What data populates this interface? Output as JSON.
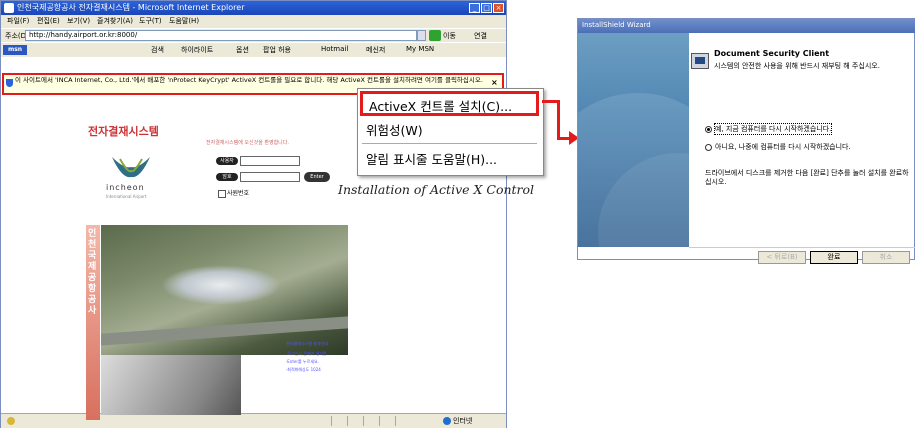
{
  "ie": {
    "title": "인천국제공항공사 전자결재시스템 - Microsoft Internet Explorer",
    "menu": [
      "파일(F)",
      "편집(E)",
      "보기(V)",
      "즐겨찾기(A)",
      "도구(T)",
      "도움말(H)"
    ],
    "address_label": "주소(D)",
    "address_value": "http://handy.airport.or.kr:8000/",
    "go_label": "이동",
    "links_label": "연결",
    "msn_label": "msn",
    "toolbar_links": [
      "검색",
      "하이라이트",
      "옵션",
      "팝업 허용",
      "Hotmail",
      "메신저",
      "My MSN"
    ],
    "infobar_text": "이 사이트에서 'INCA Internet, Co., Ltd.'에서 배포한 'nProtect KeyCrypt' ActiveX 컨트롤을 필요로 합니다. 해당 ActiveX 컨트롤을 설치하려면 여기를 클릭하십시오.",
    "infobar_close": "×",
    "status_zone": "인터넷"
  },
  "page": {
    "title": "전자결재시스템",
    "welcome": "전자결재시스템에 오신것을 환영합니다.",
    "logo_text": "incheon",
    "logo_sub": "International Airport",
    "userid_label": "사용자",
    "password_label": "암호",
    "enter_label": "Enter",
    "save_id_label": "사원번호",
    "side_text": "인천국제공항공사",
    "mini_links": [
      "전자결재시스템 설치안내",
      "·로그인시 문제가 생기면",
      "·Enter를 누르세요.",
      "·최적화해상도 1024"
    ]
  },
  "context_menu": {
    "install": "ActiveX 컨트롤 설치(C)...",
    "risk": "위험성(W)",
    "help": "알림 표시줄 도움말(H)..."
  },
  "caption": "Installation of Active X Control",
  "wizard": {
    "title": "InstallShield Wizard",
    "heading": "Document Security Client",
    "description": "시스템의 안전한 사용을 위해 반드시 재부팅 해 주십시오.",
    "option_restart_now": "예, 지금 컴퓨터를 다시 시작하겠습니다.",
    "option_restart_later": "아니요, 나중에 컴퓨터를 다시 시작하겠습니다.",
    "note": "드라이브에서 디스크를 제거한 다음 [완료] 단추를 눌러 설치를 완료하십시오.",
    "back_button": "< 뒤로(B)",
    "finish_button": "완료",
    "cancel_button": "취소"
  },
  "colors": {
    "highlight": "#e31b1b",
    "ie_title": "#2d63d9",
    "infobar_bg": "#ffffe1"
  }
}
